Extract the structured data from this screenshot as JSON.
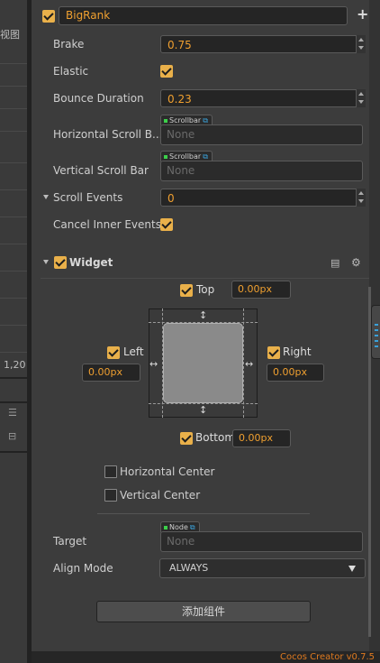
{
  "left_pane": {
    "view_label": "视图",
    "coord_text": "1,20"
  },
  "node": {
    "name": "BigRank",
    "add_label": "+"
  },
  "scrollview": {
    "brake_label": "Brake",
    "brake_value": "0.75",
    "elastic_label": "Elastic",
    "bounce_label": "Bounce Duration",
    "bounce_value": "0.23",
    "hscroll_label": "Horizontal Scroll B...",
    "hscroll_tag": "Scrollbar",
    "hscroll_value": "None",
    "vscroll_label": "Vertical Scroll Bar",
    "vscroll_tag": "Scrollbar",
    "vscroll_value": "None",
    "events_label": "Scroll Events",
    "events_value": "0",
    "cancel_label": "Cancel Inner Events"
  },
  "widget": {
    "title": "Widget",
    "top_label": "Top",
    "top_value": "0.00px",
    "left_label": "Left",
    "left_value": "0.00px",
    "right_label": "Right",
    "right_value": "0.00px",
    "bottom_label": "Bottom",
    "bottom_value": "0.00px",
    "hcenter_label": "Horizontal Center",
    "vcenter_label": "Vertical Center",
    "target_label": "Target",
    "target_tag": "Node",
    "target_value": "None",
    "align_label": "Align Mode",
    "align_value": "ALWAYS"
  },
  "add_component_label": "添加组件",
  "footer_text": "Cocos Creator v0.7.5"
}
